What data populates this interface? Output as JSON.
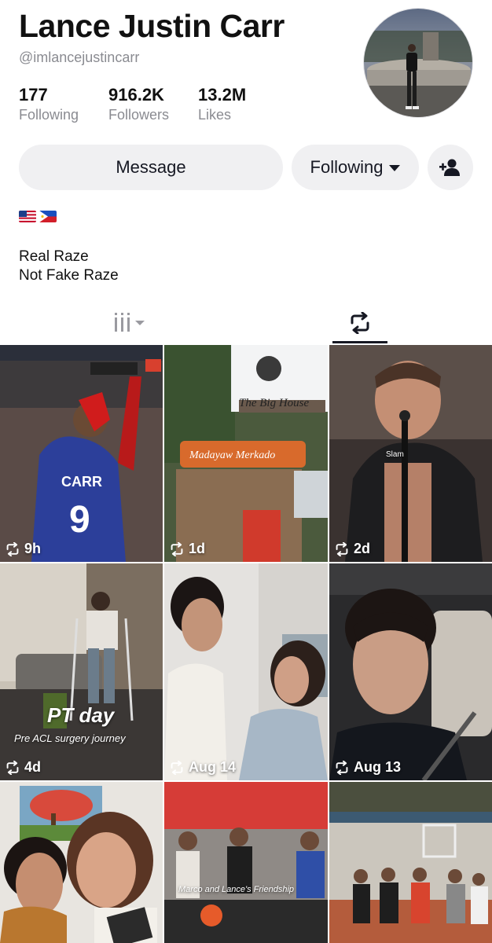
{
  "profile": {
    "name": "Lance Justin Carr",
    "handle": "@imlancejustincarr",
    "bio_lines": [
      "Real Raze",
      "Not Fake Raze"
    ],
    "flags": [
      "us-flag",
      "ph-flag"
    ]
  },
  "stats": [
    {
      "value": "177",
      "label": "Following"
    },
    {
      "value": "916.2K",
      "label": "Followers"
    },
    {
      "value": "13.2M",
      "label": "Likes"
    }
  ],
  "actions": {
    "message_label": "Message",
    "following_label": "Following"
  },
  "tabs": {
    "active": "reposts"
  },
  "videos": [
    {
      "time": "9h",
      "caption": ""
    },
    {
      "time": "1d",
      "caption": ""
    },
    {
      "time": "2d",
      "caption": "Slam"
    },
    {
      "time": "4d",
      "caption": "PT day",
      "subcaption": "Pre ACL surgery journey"
    },
    {
      "time": "Aug 14",
      "caption": ""
    },
    {
      "time": "Aug 13",
      "caption": ""
    },
    {
      "time": "",
      "caption": ""
    },
    {
      "time": "",
      "caption": "Marco and Lance's Friendship"
    },
    {
      "time": "",
      "caption": ""
    }
  ]
}
